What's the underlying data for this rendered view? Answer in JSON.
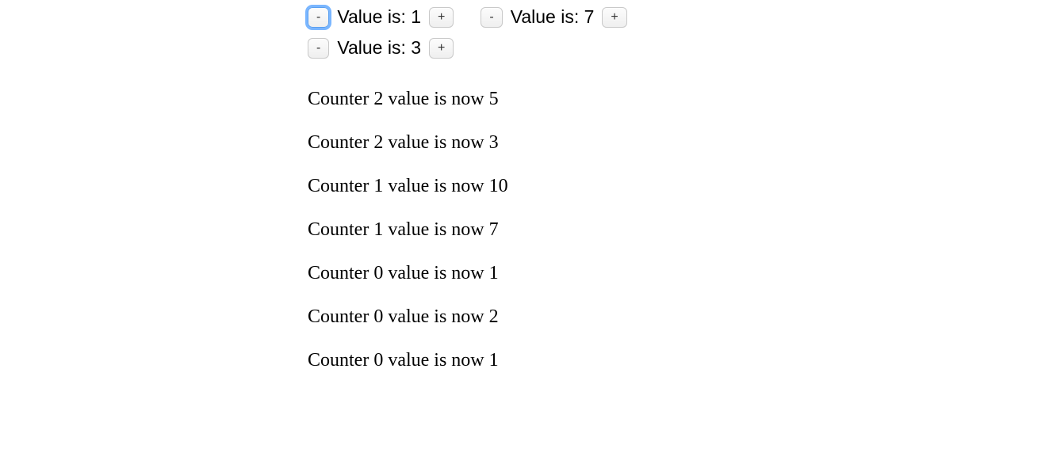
{
  "labels": {
    "value_prefix": "Value is: ",
    "minus": "-",
    "plus": "+"
  },
  "counters": [
    {
      "value": 1,
      "focused": true
    },
    {
      "value": 7,
      "focused": false
    },
    {
      "value": 3,
      "focused": false
    }
  ],
  "log": [
    "Counter 2 value is now 5",
    "Counter 2 value is now 3",
    "Counter 1 value is now 10",
    "Counter 1 value is now 7",
    "Counter 0 value is now 1",
    "Counter 0 value is now 2",
    "Counter 0 value is now 1"
  ]
}
